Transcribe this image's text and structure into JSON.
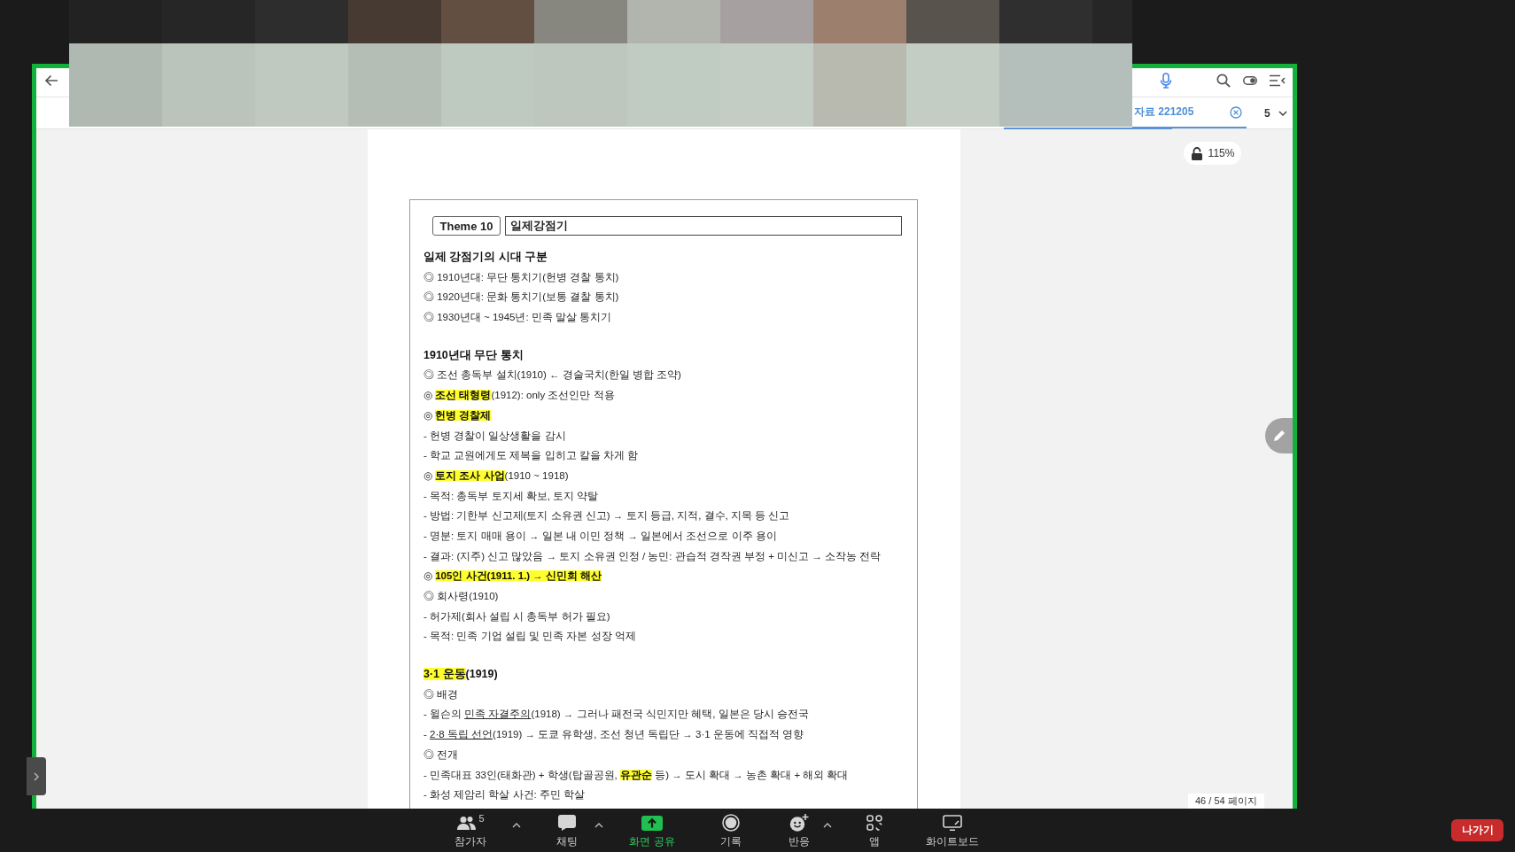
{
  "shared_window": {
    "tab": {
      "title": "자료 221205",
      "selected": true
    },
    "page_selector": "5",
    "zoom_badge": {
      "label": "115%",
      "locked": false
    },
    "page_indicator": "46 / 54 페이지"
  },
  "document": {
    "theme_label": "Theme 10",
    "title": "일제강점기",
    "sections": [
      {
        "heading": {
          "text": "일제 강점기의 시대 구분"
        },
        "lines": [
          {
            "text": "◎ 1910년대: 무단 통치기(헌병 경찰 통치)"
          },
          {
            "text": "◎ 1920년대: 문화 통치기(보통 결찰 통치)"
          },
          {
            "text": "◎ 1930년대 ~ 1945년: 민족 말살 통치기"
          }
        ]
      },
      {
        "heading": {
          "text": "1910년대 무단 통치"
        },
        "lines": [
          {
            "text": "◎ 조선 총독부 설치(1910) ← 경술국치(한일 병합 조약)"
          },
          {
            "segments": [
              {
                "text": "◎ ",
                "highlighted": false,
                "underlined": false
              },
              {
                "text": "조선 태형령",
                "highlighted": true,
                "underlined": false
              },
              {
                "text": "(1912): only 조선인만 적용",
                "highlighted": false,
                "underlined": false
              }
            ]
          },
          {
            "segments": [
              {
                "text": "◎ ",
                "highlighted": false,
                "underlined": false
              },
              {
                "text": "헌병 경찰제",
                "highlighted": true,
                "underlined": false
              }
            ]
          },
          {
            "text": "- 헌병 경찰이 일상생활을 감시"
          },
          {
            "text": "- 학교 교원에게도 제복을 입히고 칼을 차게 함"
          },
          {
            "segments": [
              {
                "text": "◎ ",
                "highlighted": false,
                "underlined": false
              },
              {
                "text": "토지 조사 사업",
                "highlighted": true,
                "underlined": false
              },
              {
                "text": "(1910 ~ 1918)",
                "highlighted": false,
                "underlined": false
              }
            ]
          },
          {
            "text": "- 목적: 총독부 토지세 확보, 토지 약탈"
          },
          {
            "text": "- 방법: 기한부 신고제(토지 소유권 신고) → 토지 등급, 지적, 결수, 지목 등 신고"
          },
          {
            "text": "- 명분: 토지 매매 용이 → 일본 내 이민 정책 → 일본에서 조선으로 이주 용이"
          },
          {
            "text": "- 결과: (지주) 신고 많았음 → 토지 소유권 인정 / 농민: 관습적 경작권 부정 + 미신고 → 소작농 전락"
          },
          {
            "segments": [
              {
                "text": "◎ ",
                "highlighted": false,
                "underlined": false
              },
              {
                "text": "105인 사건(1911. 1.) → 신민회 해산",
                "highlighted": true,
                "underlined": false
              }
            ]
          },
          {
            "text": "◎ 회사령(1910)"
          },
          {
            "text": "- 허가제(회사 설립 시 총독부 허가 필요)"
          },
          {
            "text": "- 목적: 민족 기업 설립 및 민족 자본 성장 억제"
          }
        ]
      },
      {
        "heading": {
          "segments": [
            {
              "text": "3·1 운동",
              "highlighted": true,
              "underlined": false
            },
            {
              "text": "(1919)",
              "highlighted": false,
              "underlined": false
            }
          ]
        },
        "lines": [
          {
            "text": "◎ 배경"
          },
          {
            "segments": [
              {
                "text": "- 윌슨의 ",
                "highlighted": false,
                "underlined": false
              },
              {
                "text": "민족 자결주의",
                "highlighted": false,
                "underlined": true
              },
              {
                "text": "(1918) → 그러나 패전국 식민지만 혜택, 일본은 당시 승전국",
                "highlighted": false,
                "underlined": false
              }
            ]
          },
          {
            "segments": [
              {
                "text": "- ",
                "highlighted": false,
                "underlined": false
              },
              {
                "text": "2·8 독립 선언",
                "highlighted": false,
                "underlined": true
              },
              {
                "text": "(1919) → 도쿄 유학생, 조선 청년 독립단 → 3·1 운동에 직접적 영향",
                "highlighted": false,
                "underlined": false
              }
            ]
          },
          {
            "text": "◎ 전개"
          },
          {
            "segments": [
              {
                "text": "- 민족대표 33인(태화관) + 학생(탑골공원, ",
                "highlighted": false,
                "underlined": false
              },
              {
                "text": "유관순",
                "highlighted": true,
                "underlined": false
              },
              {
                "text": " 등) → 도시 확대 → 농촌 확대 + 해외 확대",
                "highlighted": false,
                "underlined": false
              }
            ]
          },
          {
            "text": "- 화성 제암리 학살 사건: 주민 학살"
          }
        ]
      }
    ]
  },
  "meeting_toolbar": {
    "items": [
      {
        "kind": "participants",
        "label": "참가자",
        "count": "5",
        "has_menu": true
      },
      {
        "kind": "chat",
        "label": "채팅",
        "has_menu": true
      },
      {
        "kind": "share",
        "label": "화면 공유",
        "has_menu": false
      },
      {
        "kind": "record",
        "label": "기록",
        "has_menu": false
      },
      {
        "kind": "reactions",
        "label": "반응",
        "has_menu": true
      },
      {
        "kind": "apps",
        "label": "앱",
        "has_menu": false
      },
      {
        "kind": "whiteboard",
        "label": "화이트보드",
        "has_menu": false
      }
    ],
    "leave_button": "나가기"
  }
}
